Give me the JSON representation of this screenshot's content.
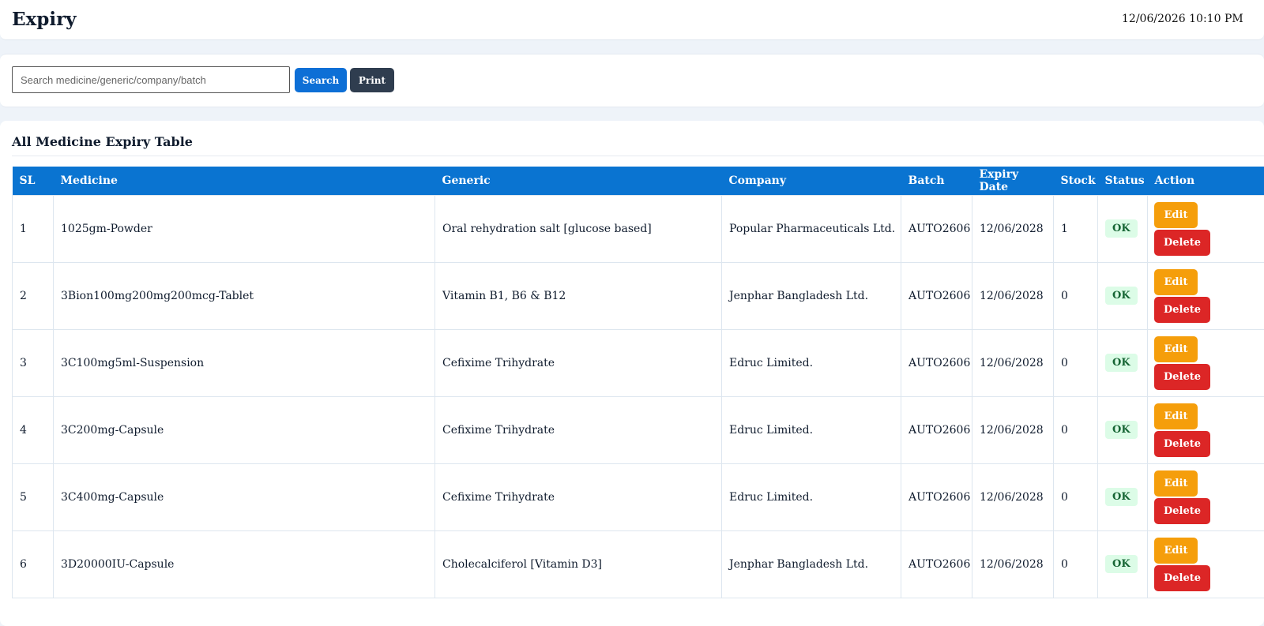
{
  "header": {
    "title": "Expiry",
    "datetime": "12/06/2026 10:10 PM"
  },
  "search": {
    "placeholder": "Search medicine/generic/company/batch",
    "value": "",
    "search_label": "Search",
    "print_label": "Print"
  },
  "table": {
    "title": "All Medicine Expiry Table",
    "columns": [
      "SL",
      "Medicine",
      "Generic",
      "Company",
      "Batch",
      "Expiry Date",
      "Stock",
      "Status",
      "Action"
    ],
    "edit_label": "Edit",
    "delete_label": "Delete",
    "rows": [
      {
        "sl": "1",
        "medicine": "1025gm-Powder",
        "generic": "Oral rehydration salt [glucose based]",
        "company": "Popular Pharmaceuticals Ltd.",
        "batch": "AUTO2606",
        "expiry": "12/06/2028",
        "stock": "1",
        "status": "OK"
      },
      {
        "sl": "2",
        "medicine": "3Bion100mg200mg200mcg-Tablet",
        "generic": "Vitamin B1, B6 & B12",
        "company": "Jenphar Bangladesh Ltd.",
        "batch": "AUTO2606",
        "expiry": "12/06/2028",
        "stock": "0",
        "status": "OK"
      },
      {
        "sl": "3",
        "medicine": "3C100mg5ml-Suspension",
        "generic": "Cefixime Trihydrate",
        "company": "Edruc Limited.",
        "batch": "AUTO2606",
        "expiry": "12/06/2028",
        "stock": "0",
        "status": "OK"
      },
      {
        "sl": "4",
        "medicine": "3C200mg-Capsule",
        "generic": "Cefixime Trihydrate",
        "company": "Edruc Limited.",
        "batch": "AUTO2606",
        "expiry": "12/06/2028",
        "stock": "0",
        "status": "OK"
      },
      {
        "sl": "5",
        "medicine": "3C400mg-Capsule",
        "generic": "Cefixime Trihydrate",
        "company": "Edruc Limited.",
        "batch": "AUTO2606",
        "expiry": "12/06/2028",
        "stock": "0",
        "status": "OK"
      },
      {
        "sl": "6",
        "medicine": "3D20000IU-Capsule",
        "generic": "Cholecalciferol [Vitamin D3]",
        "company": "Jenphar Bangladesh Ltd.",
        "batch": "AUTO2606",
        "expiry": "12/06/2028",
        "stock": "0",
        "status": "OK"
      }
    ]
  }
}
